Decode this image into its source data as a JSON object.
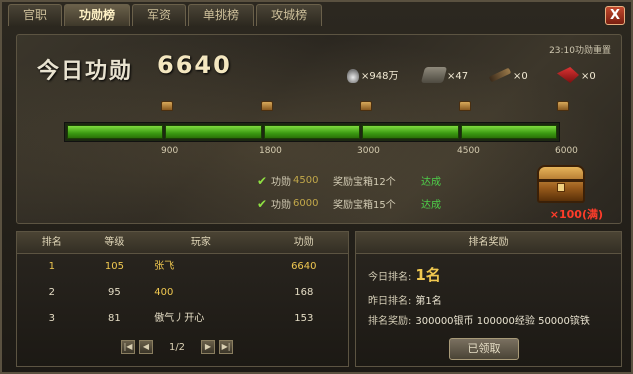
{
  "tabs": [
    "官职",
    "功勋榜",
    "军资",
    "单挑榜",
    "攻城榜"
  ],
  "active_tab": 1,
  "close_label": "X",
  "merit": {
    "title": "今日功勋",
    "value": "6640",
    "reset_note": "23:10功勋重置"
  },
  "resources": [
    {
      "icon": "silver-ingot-icon",
      "count": "×948万"
    },
    {
      "icon": "tank-icon",
      "count": "×47"
    },
    {
      "icon": "cannon-icon",
      "count": "×0"
    },
    {
      "icon": "fighter-jet-icon",
      "count": "×0"
    }
  ],
  "progress": {
    "fraction": 1.0,
    "ticks": [
      "900",
      "1800",
      "3000",
      "4500",
      "6000"
    ]
  },
  "tasks": [
    {
      "name": "功勋",
      "goal": "4500",
      "reward": "奖励宝箱12个",
      "status": "达成"
    },
    {
      "name": "功勋",
      "goal": "6000",
      "reward": "奖励宝箱15个",
      "status": "达成"
    }
  ],
  "chest_count": "×100(满)",
  "ranking": {
    "headers": [
      "排名",
      "等级",
      "玩家",
      "功勋"
    ],
    "rows": [
      {
        "rank": "1",
        "level": "105",
        "player": "张飞",
        "merit": "6640"
      },
      {
        "rank": "2",
        "level": "95",
        "player": "400",
        "merit": "168"
      },
      {
        "rank": "3",
        "level": "81",
        "player": "傲气丿开心",
        "merit": "153"
      }
    ],
    "page": "1/2"
  },
  "rank_reward": {
    "title": "排名奖励",
    "today_label": "今日排名:",
    "today_value": "1名",
    "yesterday_label": "昨日排名:",
    "yesterday_value": "第1名",
    "reward_label": "排名奖励:",
    "reward_value": "300000银币 100000经验 50000镔铁",
    "claim_label": "已领取"
  },
  "colors": {
    "accent": "#f0c850",
    "done": "#4ed04a",
    "bar": "#5fc22a",
    "full": "#ff3c2a"
  }
}
